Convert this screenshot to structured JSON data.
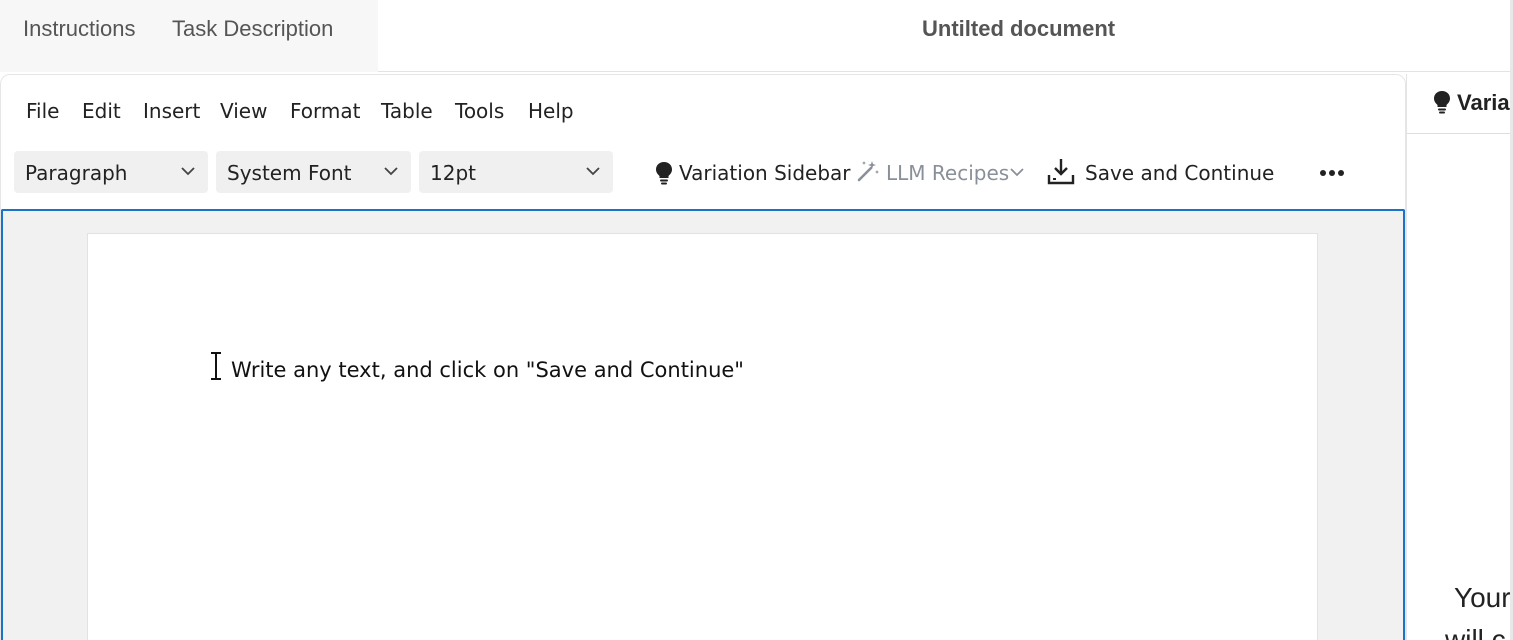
{
  "header": {
    "tabs": [
      "Instructions",
      "Task Description"
    ],
    "document_title": "Untilted document"
  },
  "menu": [
    "File",
    "Edit",
    "Insert",
    "View",
    "Format",
    "Table",
    "Tools",
    "Help"
  ],
  "toolbar": {
    "block_format": "Paragraph",
    "font_family": "System Font",
    "font_size": "12pt",
    "variation_sidebar_label": "Variation Sidebar",
    "llm_recipes_label": "LLM Recipes",
    "save_continue_label": "Save and Continue",
    "more_icon": "ellipsis-icon"
  },
  "document": {
    "placeholder_text": "Write any text, and click on \"Save and Continue\""
  },
  "sidebar": {
    "title": "Varia",
    "body_line1": "Your",
    "body_line2": "will c"
  },
  "colors": {
    "focus_border": "#1a73c9",
    "disabled_text": "#8a9099",
    "tab_background": "#f7f7f7"
  }
}
